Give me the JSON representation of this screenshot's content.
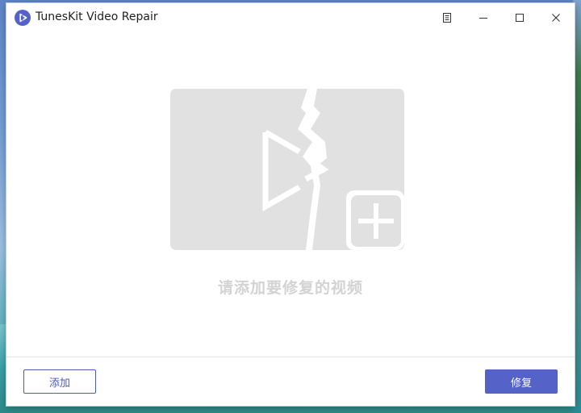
{
  "window": {
    "title": "TunesKit Video Repair"
  },
  "titlebar_controls": {
    "menu_icon": "menu-list-icon",
    "minimize_icon": "minimize-icon",
    "maximize_icon": "maximize-icon",
    "close_icon": "close-icon"
  },
  "main": {
    "drop_icon": "broken-video-add-icon",
    "hint_text": "请添加要修复的视频"
  },
  "footer": {
    "add_label": "添加",
    "repair_label": "修复"
  },
  "colors": {
    "accent": "#5563c8",
    "placeholder_gray": "#e1e1e1",
    "hint_text": "#d3d3d3"
  }
}
